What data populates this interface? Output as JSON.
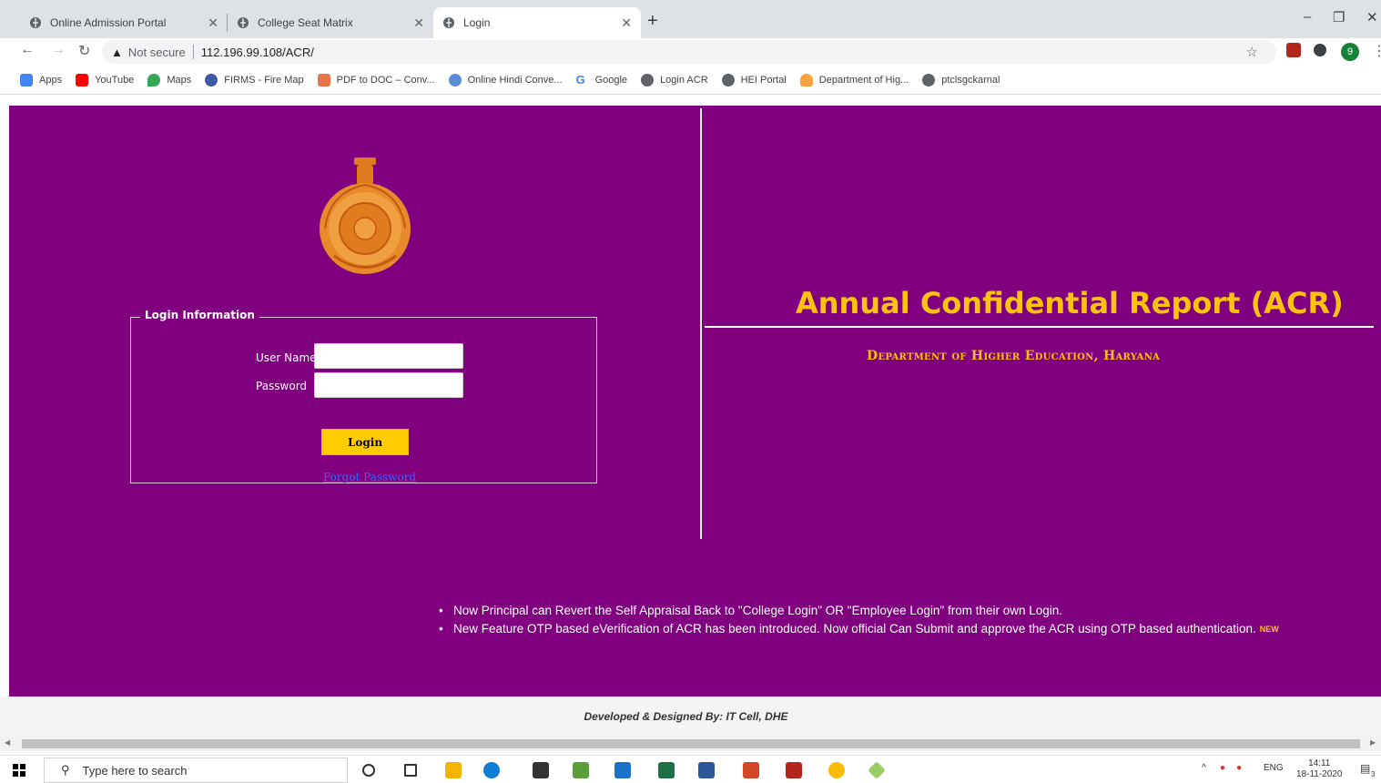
{
  "browser": {
    "tabs": [
      {
        "title": "Online Admission Portal",
        "active": false
      },
      {
        "title": "College Seat Matrix",
        "active": false
      },
      {
        "title": "Login",
        "active": true
      }
    ],
    "new_tab_symbol": "+",
    "window_controls": {
      "minimize": "–",
      "restore": "❐",
      "close": "✕"
    },
    "not_secure_label": "Not secure",
    "url": "112.196.99.108/ACR/",
    "profile_initial": "9",
    "bookmarks": [
      {
        "label": "Apps",
        "icon": "apps-grid-icon",
        "color": "#4285f4"
      },
      {
        "label": "YouTube",
        "icon": "youtube-icon",
        "color": "#ff0000"
      },
      {
        "label": "Maps",
        "icon": "maps-pin-icon",
        "color": "#34a853"
      },
      {
        "label": "FIRMS - Fire Map",
        "icon": "firms-icon",
        "color": "#3c5aa6"
      },
      {
        "label": "PDF to DOC – Conv...",
        "icon": "pdf-doc-icon",
        "color": "#e8744a"
      },
      {
        "label": "Online Hindi Conve...",
        "icon": "hindi-converter-icon",
        "color": "#5b8dd6"
      },
      {
        "label": "Google",
        "icon": "google-icon",
        "color": "#4285f4"
      },
      {
        "label": "Login ACR",
        "icon": "globe-icon",
        "color": "#5f6368"
      },
      {
        "label": "HEI Portal",
        "icon": "globe-icon",
        "color": "#5f6368"
      },
      {
        "label": "Department of Hig...",
        "icon": "department-icon",
        "color": "#f4a340"
      },
      {
        "label": "ptclsgckarnal",
        "icon": "globe-icon",
        "color": "#5f6368"
      }
    ]
  },
  "page": {
    "background": "#800080",
    "accent": "#ffc20e",
    "login": {
      "legend": "Login Information",
      "username_label": "User Name",
      "password_label": "Password",
      "login_button": "Login",
      "forgot_password": "Forgot Password"
    },
    "title": "Annual Confidential Report (ACR)",
    "department": "Department of Higher Education, Haryana",
    "notices": [
      {
        "text": "Now Principal can Revert the Self Appraisal Back to \"College Login\" OR \"Employee Login\" from their own Login.",
        "badge": ""
      },
      {
        "text": "New Feature OTP based eVerification of ACR has been introduced. Now official Can Submit and approve the ACR using OTP based authentication.",
        "badge": "NEW"
      }
    ],
    "footer": "Developed & Designed By: IT Cell, DHE"
  },
  "taskbar": {
    "search_placeholder": "Type here to search",
    "language": "ENG",
    "time": "14:11",
    "date": "18-11-2020",
    "notification_count": "3"
  }
}
